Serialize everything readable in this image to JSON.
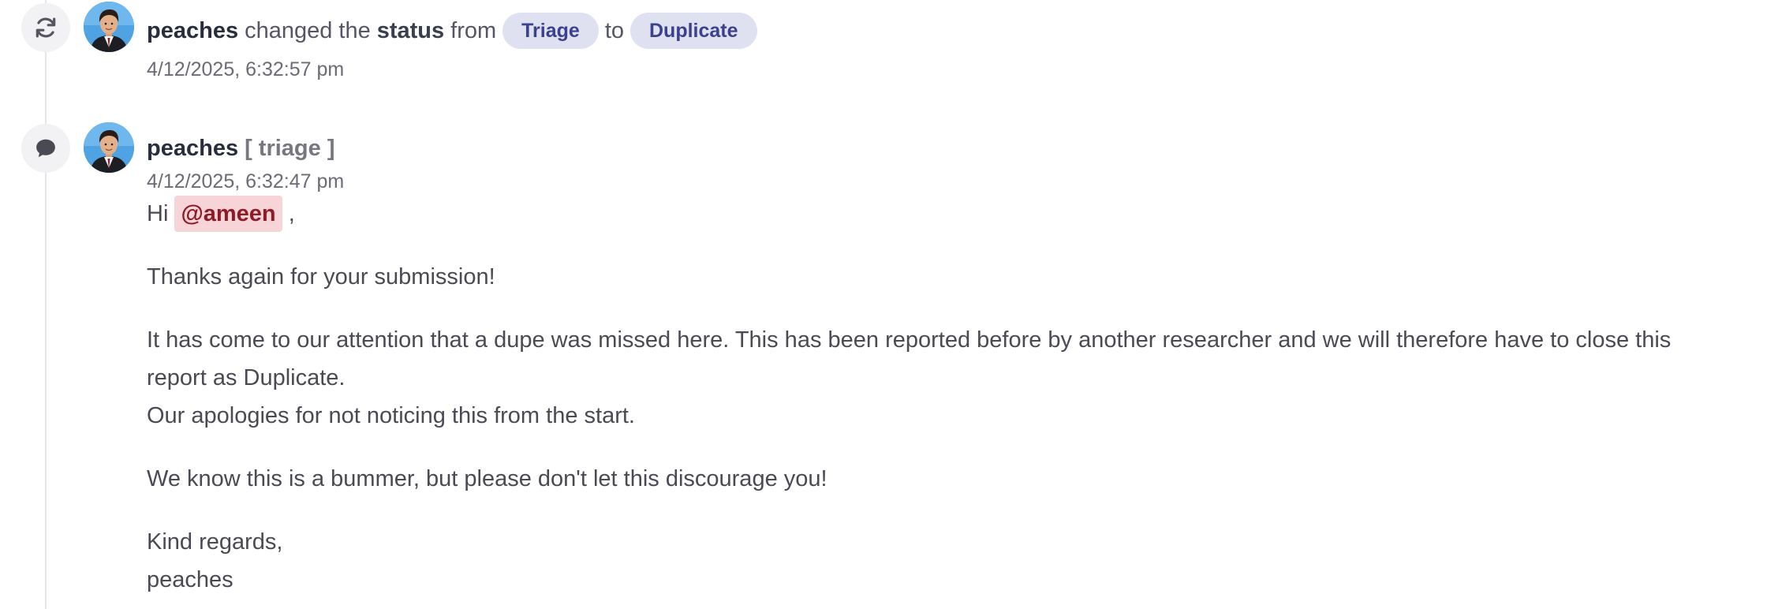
{
  "status_event": {
    "username": "peaches",
    "text_changed_the": "changed the",
    "text_status": "status",
    "text_from": "from",
    "from_status": "Triage",
    "text_to": "to",
    "to_status": "Duplicate",
    "timestamp": "4/12/2025, 6:32:57 pm",
    "icon": "refresh-icon"
  },
  "comment_event": {
    "username": "peaches",
    "role": "[ triage ]",
    "timestamp": "4/12/2025, 6:32:47 pm",
    "icon": "comment-icon",
    "greeting": "Hi",
    "mention": "@ameen",
    "greeting_suffix": ",",
    "paragraph_1": "Thanks again for your submission!",
    "paragraph_2_line_1": "It has come to our attention that a dupe was missed here. This has been reported before by another researcher and we will therefore have to close this",
    "paragraph_2_line_2": "report as Duplicate.",
    "paragraph_2_line_3": "Our apologies for not noticing this from the start.",
    "paragraph_3": "We know this is a bummer, but please don't let this discourage you!",
    "sign_off": "Kind regards,",
    "signature": "peaches"
  },
  "colors": {
    "pill_bg": "#dfe1f0",
    "pill_text": "#3b418c",
    "mention_bg": "#f7d4d7",
    "mention_text": "#8e1b25"
  }
}
